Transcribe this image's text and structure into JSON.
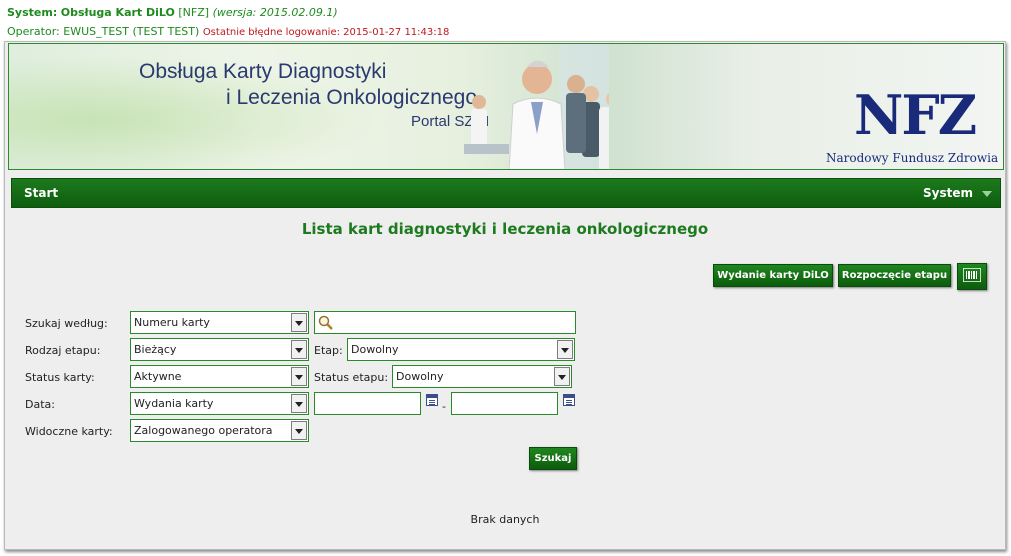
{
  "header": {
    "system_label": "System:",
    "system_name": "Obsługa Kart DiLO",
    "system_tag": "[NFZ]",
    "version": "(wersja: 2015.02.09.1)",
    "operator_label": "Operator:",
    "operator_value": "EWUS_TEST (TEST TEST)",
    "last_failed_login": "Ostatnie błędne logowanie: 2015-01-27 11:43:18"
  },
  "banner": {
    "title_line1": "Obsługa Karty Diagnostyki",
    "title_line2": "i Leczenia Onkologicznego",
    "portal": "Portal SZOI",
    "nfz_logo": "NFZ",
    "nfz_name": "Narodowy Fundusz Zdrowia"
  },
  "nav": {
    "start": "Start",
    "system": "System"
  },
  "main": {
    "title": "Lista kart diagnostyki i leczenia onkologicznego",
    "actions": {
      "issue_card": "Wydanie karty DiLO",
      "start_stage": "Rozpoczęcie etapu",
      "barcode_icon": "barcode-icon"
    },
    "filters": {
      "search_by_label": "Szukaj według:",
      "search_by_value": "Numeru karty",
      "search_input_value": "",
      "stage_type_label": "Rodzaj etapu:",
      "stage_type_value": "Bieżący",
      "stage_label": "Etap:",
      "stage_value": "Dowolny",
      "card_status_label": "Status karty:",
      "card_status_value": "Aktywne",
      "stage_status_label": "Status etapu:",
      "stage_status_value": "Dowolny",
      "date_label": "Data:",
      "date_value": "Wydania karty",
      "date_from": "",
      "date_separator": "-",
      "date_to": "",
      "visible_cards_label": "Widoczne karty:",
      "visible_cards_value": "Zalogowanego operatora",
      "search_button": "Szukaj"
    },
    "no_data": "Brak danych"
  }
}
